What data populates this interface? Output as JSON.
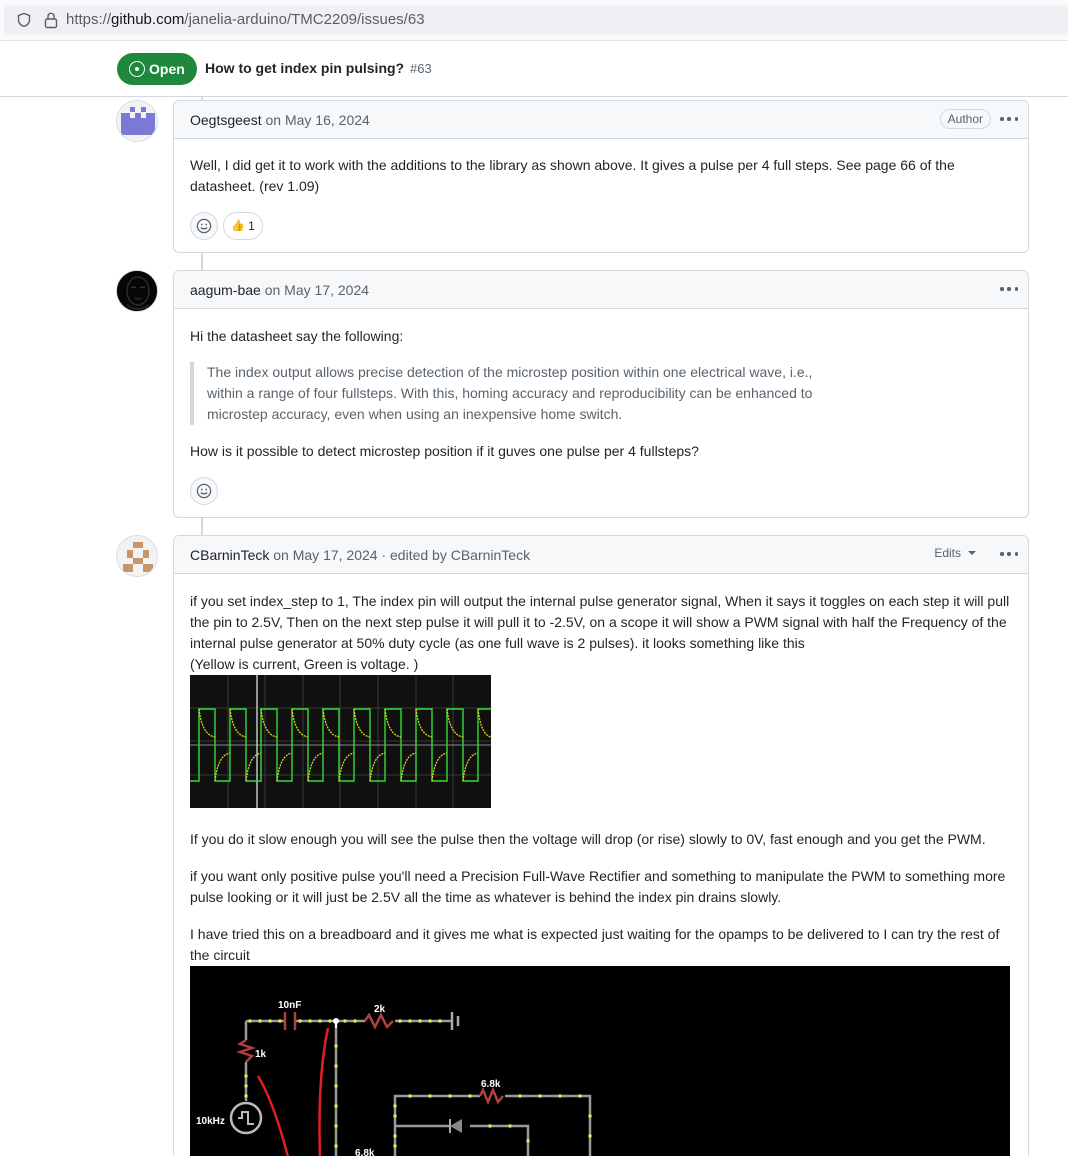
{
  "browser": {
    "url_prefix": "https://",
    "url_host": "github.com",
    "url_path": "/janelia-arduino/TMC2209/issues/63"
  },
  "issue": {
    "state": "Open",
    "title": "How to get index pin pulsing?",
    "number": "#63"
  },
  "comments": [
    {
      "author": "Oegtsgeest",
      "date": "on May 16, 2024",
      "badge": "Author",
      "body": "Well, I did get it to work with the additions to the library as shown above. It gives a pulse per 4 full steps. See page 66 of the datasheet. (rev 1.09)",
      "reaction": {
        "emoji": "👍",
        "count": "1"
      }
    },
    {
      "author": "aagum-bae",
      "date": "on May 17, 2024",
      "intro": "Hi the datasheet say the following:",
      "quote": "The index output allows precise detection of the microstep position within one electrical wave, i.e., within a range of four fullsteps. With this, homing accuracy and reproducibility can be enhanced to microstep accuracy, even when using an inexpensive home switch.",
      "question": "How is it possible to detect microstep position if it guves one pulse per 4 fullsteps?"
    },
    {
      "author": "CBarninTeck",
      "date": "on May 17, 2024",
      "edited_by": "· edited by CBarninTeck",
      "edits_label": "Edits",
      "para1": "if you set index_step to 1, The index pin will output the internal pulse generator signal, When it says it toggles on each step it will pull the pin to 2.5V, Then on the next step pulse it will pull it to -2.5V, on a scope it will show a PWM signal with half the Frequency of the internal pulse generator at 50% duty cycle (as one full wave is 2 pulses). it looks something like this",
      "para1b": "(Yellow is current, Green is voltage. )",
      "para2": "If you do it slow enough you will see the pulse then the voltage will drop (or rise) slowly to 0V, fast enough and you get the PWM.",
      "para3": "if you want only positive pulse you'll need a Precision Full-Wave Rectifier and something to manipulate the PWM to something more pulse looking or it will just be 2.5V all the time as whatever is behind the index pin drains slowly.",
      "para4": "I have tried this on a breadboard and it gives me what is expected just waiting for the opamps to be delivered to I can try the rest of the circuit",
      "circuit_labels": {
        "cap": "10nF",
        "r1": "2k",
        "r2": "1k",
        "src": "10kHz",
        "r3": "6.8k",
        "r4": "6.8k"
      }
    }
  ]
}
